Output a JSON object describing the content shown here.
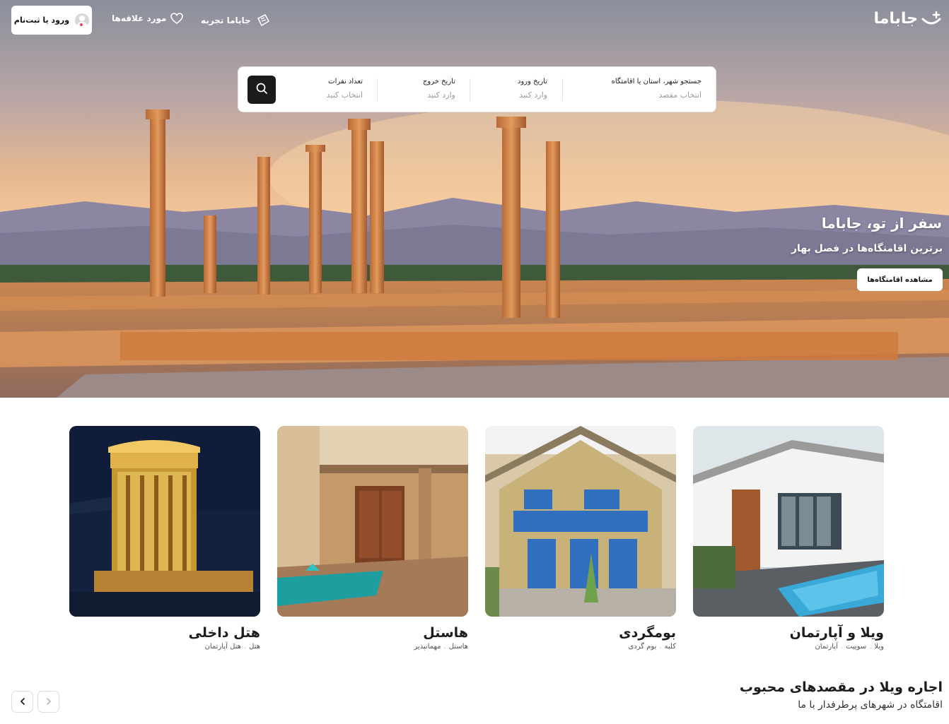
{
  "header": {
    "logo_text": "جاباما",
    "experience_label": "جاباما تجربه",
    "favorites_label": "مورد علاقه‌ها",
    "login_label": "ورود یا ثبت‌نام"
  },
  "search": {
    "destination": {
      "label": "جستجو شهر، استان یا اقامتگاه",
      "placeholder": "انتخاب مقصد"
    },
    "checkin": {
      "label": "تاریخ ورود",
      "placeholder": "وارد کنید"
    },
    "checkout": {
      "label": "تاریخ خروج",
      "placeholder": "وارد کنید"
    },
    "guests": {
      "label": "تعداد نفرات",
      "placeholder": "انتخاب کنید"
    }
  },
  "hero": {
    "title": "سفر از تو، جاباما",
    "subtitle": "برترین اقامتگاه‌ها در فصل بهار",
    "button_label": "مشاهده اقامتگاه‌ها"
  },
  "categories": [
    {
      "title": "ویلا و آپارتمان",
      "tags": [
        "ویلا",
        "سوییت",
        "آپارتمان"
      ]
    },
    {
      "title": "بومگردی",
      "tags": [
        "کلبه",
        "بوم گردی"
      ]
    },
    {
      "title": "هاستل",
      "tags": [
        "هاستل",
        "مهمانپذیر"
      ]
    },
    {
      "title": "هتل داخلی",
      "tags": [
        "هتل",
        "هتل آپارتمان"
      ]
    }
  ],
  "section": {
    "title": "اجاره ویلا در مقصدهای محبوب",
    "subtitle": "اقامتگاه در شهرهای پرطرفدار با ما"
  },
  "icons": {
    "logo": "smile-plus-icon",
    "experience": "map-ticket-icon",
    "favorites": "heart-icon",
    "search": "search-icon",
    "next": "chevron-left-icon",
    "prev": "chevron-right-icon"
  }
}
